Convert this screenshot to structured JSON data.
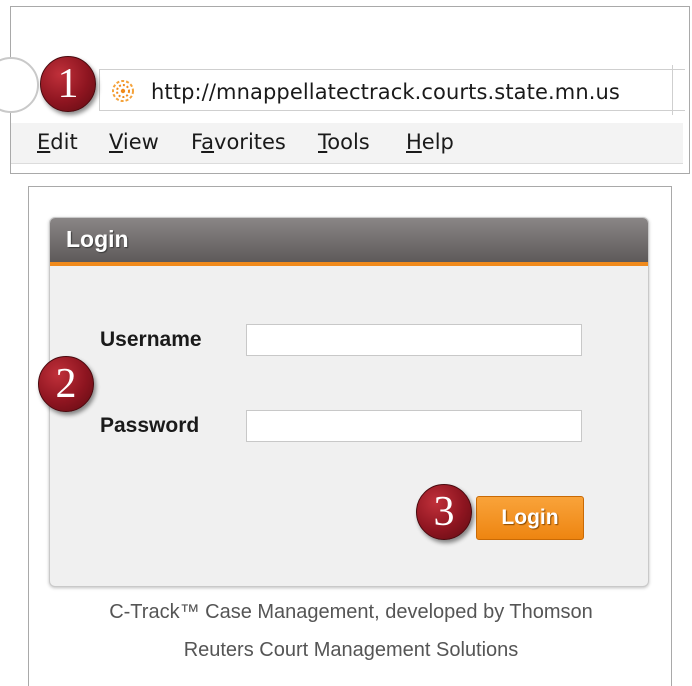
{
  "browser": {
    "url": "http://mnappellatectrack.courts.state.mn.us",
    "menu": [
      {
        "accel": "E",
        "rest": "dit"
      },
      {
        "accel": "V",
        "rest": "iew"
      },
      {
        "pre": "F",
        "accel": "a",
        "rest": "vorites"
      },
      {
        "accel": "T",
        "rest": "ools"
      },
      {
        "accel": "H",
        "rest": "elp"
      }
    ]
  },
  "login": {
    "title": "Login",
    "username_label": "Username",
    "password_label": "Password",
    "username_value": "",
    "password_value": "",
    "button_label": "Login"
  },
  "footer": {
    "line1": "C-Track™ Case Management, developed by Thomson",
    "line2": "Reuters Court Management Solutions"
  },
  "steps": [
    "1",
    "2",
    "3"
  ],
  "colors": {
    "accent_orange": "#ee8511",
    "header_gray": "#6e6a6a",
    "badge_red": "#8e1520"
  },
  "icons": {
    "site": "site-favicon-icon"
  }
}
